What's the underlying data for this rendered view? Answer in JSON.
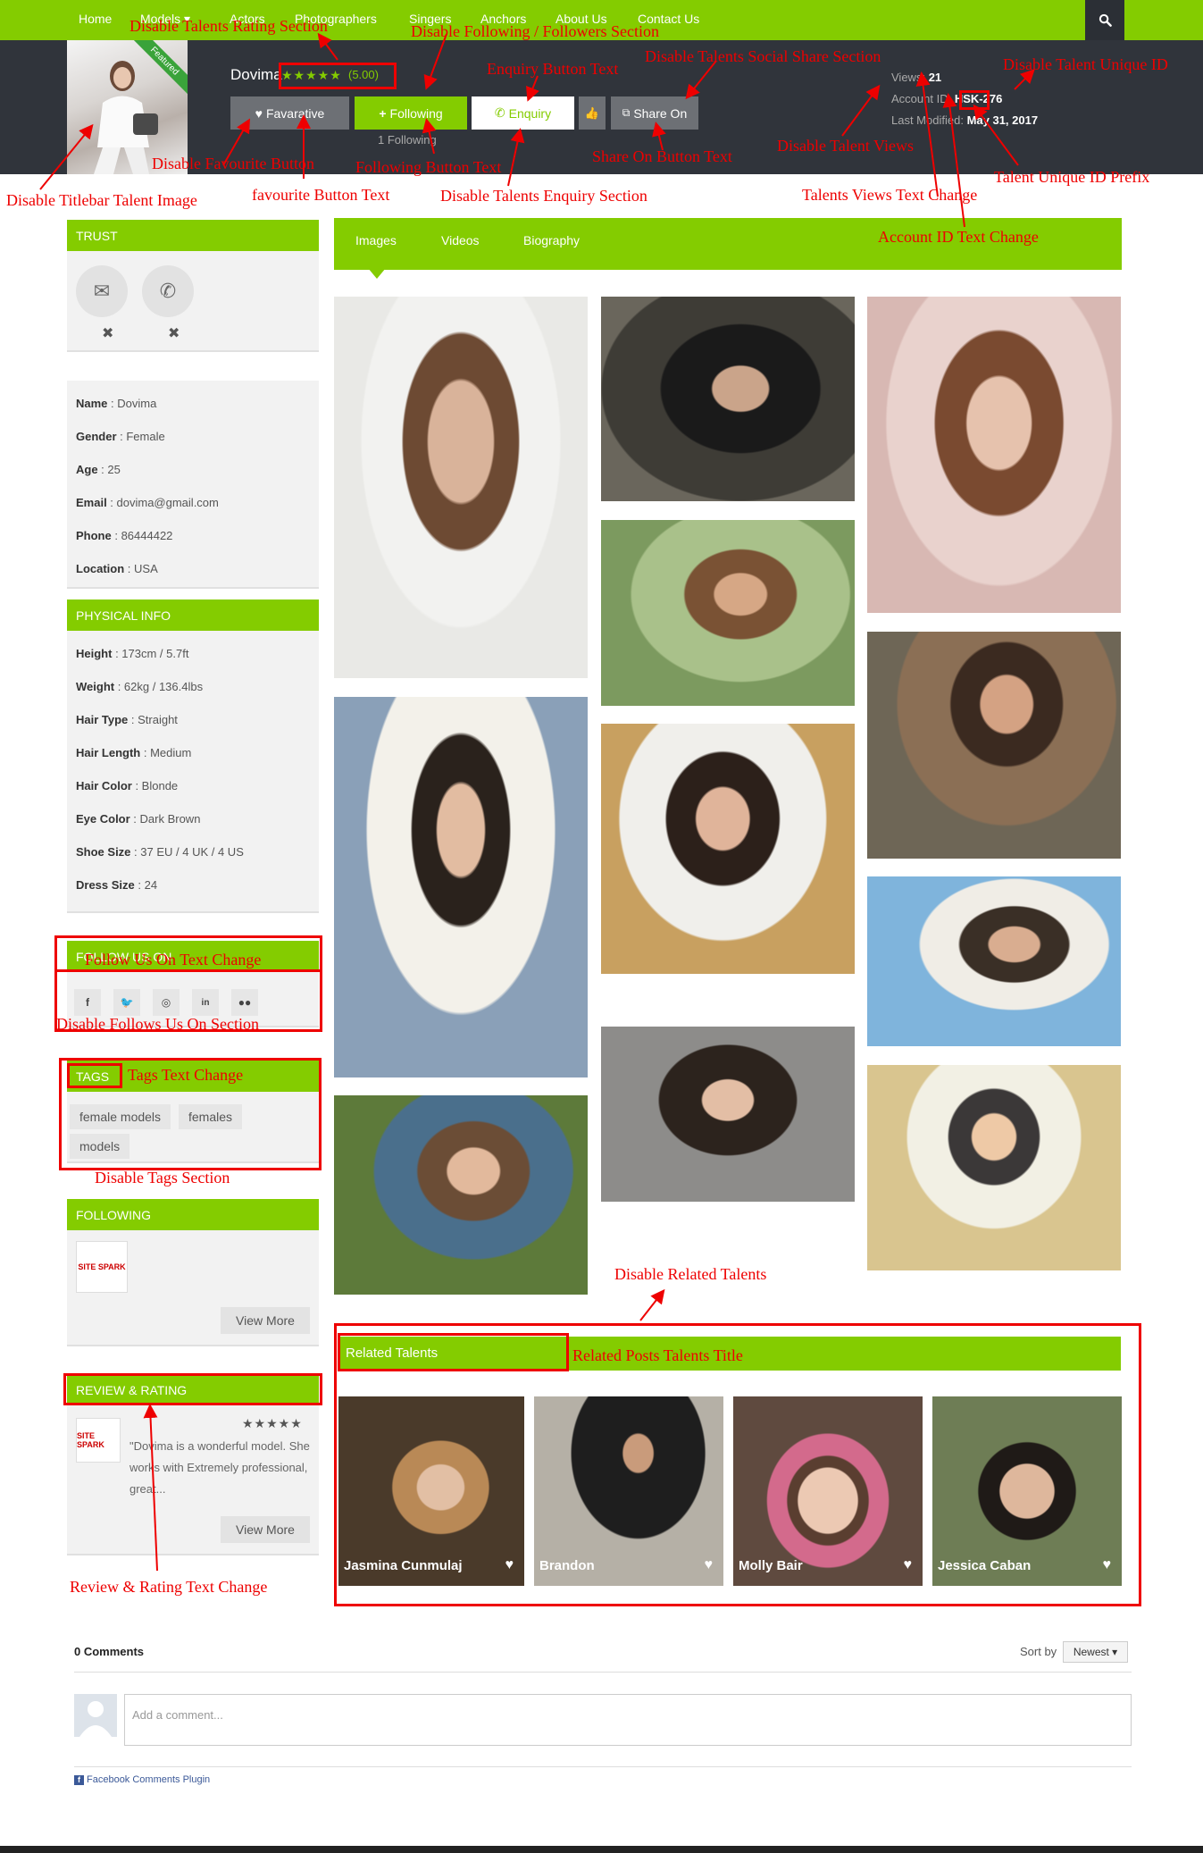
{
  "nav": {
    "items": [
      "Home",
      "Models ▾",
      "Actors",
      "Photographers",
      "Singers",
      "Anchors",
      "About Us",
      "Contact Us"
    ],
    "search_icon": "search-icon"
  },
  "titlebar": {
    "ribbon": "Featured",
    "name": "Dovima",
    "stars": "★★★★★",
    "rating": "(5.00)",
    "favourite_label": "Favarative",
    "following_label": "Following",
    "enquiry_label": "Enquiry",
    "share_label": "Share On",
    "following_count": "1 Following",
    "views_label": "Views:",
    "views_value": "21",
    "account_label": "Account ID:",
    "account_value": "HSK-276",
    "modified_label": "Last Modified:",
    "modified_value": "May 31, 2017"
  },
  "annotations": {
    "rating_section": "Disable Talents Rating Section",
    "following_section": "Disable Following / Followers Section",
    "enquiry_button_text": "Enquiry Button Text",
    "social_share": "Disable Talents Social Share Section",
    "unique_id": "Disable Talent Unique ID",
    "favourite_button": "Disable Favourite Button",
    "following_button_text": "Following Button Text",
    "share_button_text": "Share On Button Text",
    "talent_views": "Disable Talent Views",
    "unique_id_prefix": "Talent Unique ID Prefix",
    "titlebar_image": "Disable Titlebar Talent Image",
    "favourite_text": "favourite Button Text",
    "enquiry_section": "Disable Talents Enquiry Section",
    "views_text": "Talents Views Text Change",
    "account_text": "Account ID Text Change",
    "follow_us_text": "Follow Us On Text Change",
    "follow_us_section": "Disable Follows Us On Section",
    "tags_text": "Tags Text Change",
    "tags_section": "Disable Tags Section",
    "related_talents": "Disable Related Talents",
    "related_title": "Related Posts Talents Title",
    "review_text": "Review & Rating Text Change"
  },
  "sidebar": {
    "trust_title": "Trust",
    "personal": [
      {
        "k": "Name",
        "v": " : Dovima"
      },
      {
        "k": "Gender",
        "v": " : Female"
      },
      {
        "k": "Age",
        "v": " : 25"
      },
      {
        "k": "Email",
        "v": " : dovima@gmail.com"
      },
      {
        "k": "Phone",
        "v": " : 86444422"
      },
      {
        "k": "Location",
        "v": " : USA"
      }
    ],
    "physical_title": "Physical Info",
    "physical": [
      {
        "k": "Height",
        "v": " : 173cm / 5.7ft"
      },
      {
        "k": "Weight",
        "v": " : 62kg / 136.4lbs"
      },
      {
        "k": "Hair Type",
        "v": " : Straight"
      },
      {
        "k": "Hair Length",
        "v": " : Medium"
      },
      {
        "k": "Hair Color",
        "v": " : Blonde"
      },
      {
        "k": "Eye Color",
        "v": " : Dark Brown"
      },
      {
        "k": "Shoe Size",
        "v": " : 37 EU / 4 UK / 4 US"
      },
      {
        "k": "Dress Size",
        "v": " : 24"
      }
    ],
    "follow_title": "Follow Us On",
    "tags_title": "Tags",
    "tags": [
      "female models",
      "females",
      "models"
    ],
    "following_title": "Following",
    "following_logo": "SITE SPARK",
    "view_more": "View More",
    "review_title": "Review & Rating",
    "review_stars": "★★★★★",
    "review_text": "\"Dovima is a wonderful model. She works with Extremely professional, great...",
    "review_logo": "SITE SPARK"
  },
  "tabs": [
    "Images",
    "Videos",
    "Biography"
  ],
  "related": {
    "title": "Related Talents",
    "items": [
      "Jasmina Cunmulaj",
      "Brandon",
      "Molly Bair",
      "Jessica Caban"
    ]
  },
  "comments": {
    "count": "0 Comments",
    "sort_label": "Sort by",
    "sort_value": "Newest ▾",
    "placeholder": "Add a comment...",
    "plugin": "Facebook Comments Plugin"
  }
}
